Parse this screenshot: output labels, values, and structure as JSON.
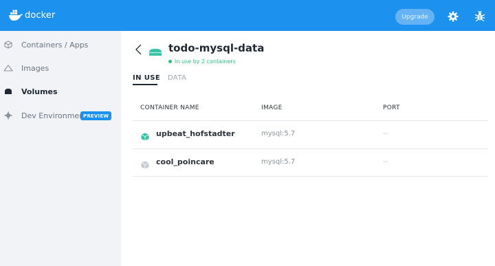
{
  "app": {
    "name": "docker"
  },
  "topbar": {
    "upgrade_label": "Upgrade",
    "icons": [
      "settings-gear-icon",
      "bug-icon"
    ]
  },
  "sidebar": {
    "items": [
      {
        "label": "Containers / Apps",
        "icon": "containers-icon",
        "active": false
      },
      {
        "label": "Images",
        "icon": "images-icon",
        "active": false
      },
      {
        "label": "Volumes",
        "icon": "volumes-icon",
        "active": true
      },
      {
        "label": "Dev Environments",
        "icon": "dev-environments-icon",
        "active": false,
        "badge": "PREVIEW"
      }
    ]
  },
  "volume": {
    "name": "todo-mysql-data",
    "status": "In use by 2 containers"
  },
  "tabs": [
    {
      "label": "IN USE",
      "active": true
    },
    {
      "label": "DATA",
      "active": false
    }
  ],
  "table": {
    "headers": [
      "CONTAINER NAME",
      "IMAGE",
      "PORT"
    ],
    "rows": [
      {
        "name": "upbeat_hofstadter",
        "image": "mysql:5.7",
        "port": "--",
        "running": true
      },
      {
        "name": "cool_poincare",
        "image": "mysql:5.7",
        "port": "--",
        "running": false
      }
    ]
  },
  "colors": {
    "brand": "#1d91ee",
    "running": "#36c2a6",
    "stopped": "#c5cbd1",
    "status_green": "#2bbf7a"
  }
}
